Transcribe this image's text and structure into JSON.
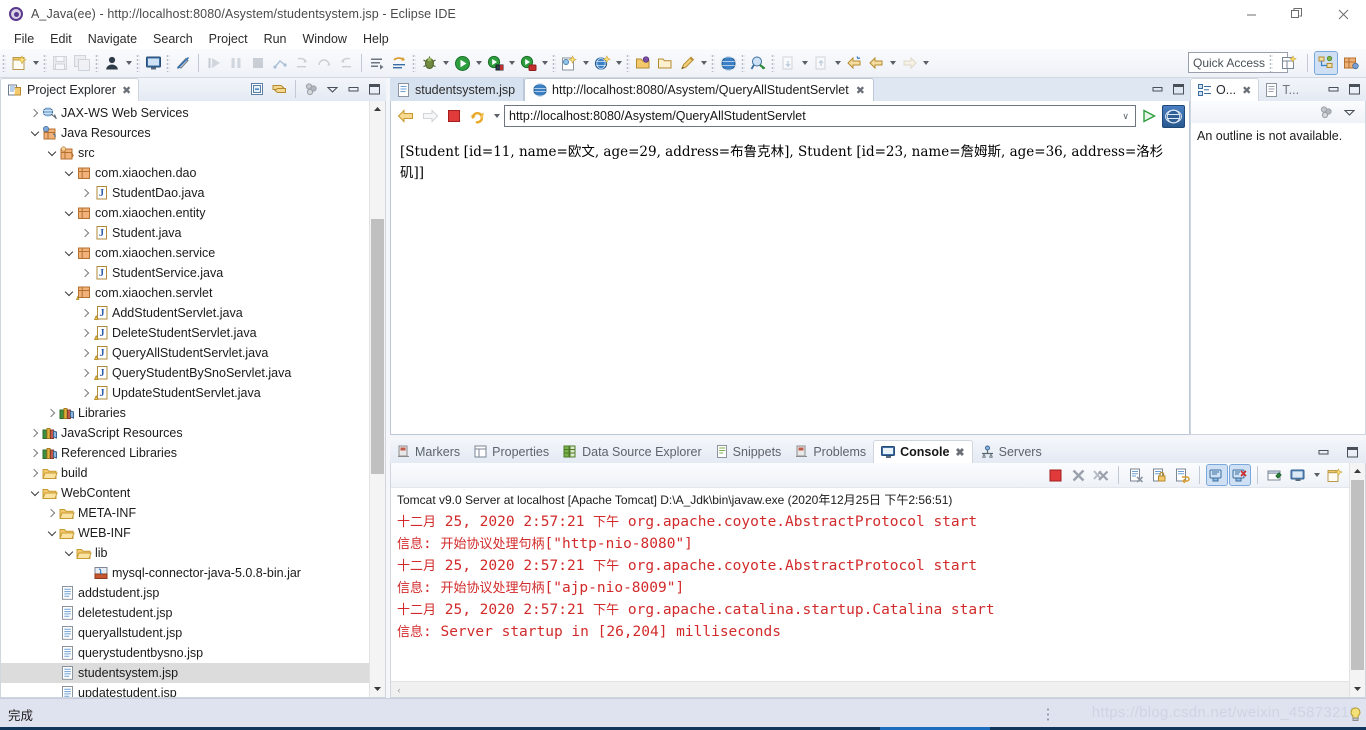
{
  "window": {
    "title": "A_Java(ee) - http://localhost:8080/Asystem/studentsystem.jsp - Eclipse IDE",
    "icon": "eclipse-icon",
    "minimize": "—",
    "maximize": "❐",
    "close": "✕"
  },
  "menubar": {
    "items": [
      {
        "label": "File"
      },
      {
        "label": "Edit"
      },
      {
        "label": "Navigate"
      },
      {
        "label": "Search"
      },
      {
        "label": "Project"
      },
      {
        "label": "Run"
      },
      {
        "label": "Window"
      },
      {
        "label": "Help"
      }
    ]
  },
  "toolbar": {
    "quick_access_placeholder": "Quick Access",
    "buttons": [
      "new-wizard",
      "save",
      "save-all",
      "user-profile",
      "terminal",
      "toggle-mark-occurrences",
      "skip-breakpoints",
      "resume",
      "suspend",
      "terminate",
      "disconnect",
      "step-into",
      "step-over",
      "step-return",
      "drop-to-frame",
      "next-annotation",
      "previous-annotation",
      "debug",
      "run",
      "run-last-tool",
      "coverage",
      "new-jsp",
      "new-dynamic-web-project",
      "open-type",
      "open-task",
      "external-tools",
      "web-browser",
      "search",
      "forward-history",
      "back-history"
    ],
    "perspective_buttons": [
      "open-perspective",
      "java-ee-perspective",
      "java-perspective"
    ]
  },
  "project_explorer": {
    "tab_label": "Project Explorer",
    "tab_close": "✖",
    "toolbar": [
      "collapse-all",
      "link-with-editor",
      "view-menu-dots",
      "view-menu-triangle",
      "minimize",
      "maximize"
    ],
    "tree": [
      {
        "indent": 1,
        "twist": "closed",
        "icon": "web-services-icon",
        "label": "JAX-WS Web Services"
      },
      {
        "indent": 1,
        "twist": "open",
        "icon": "java-resources-icon",
        "label": "Java Resources"
      },
      {
        "indent": 2,
        "twist": "open",
        "icon": "source-folder-icon",
        "label": "src"
      },
      {
        "indent": 3,
        "twist": "open",
        "icon": "package-icon",
        "label": "com.xiaochen.dao"
      },
      {
        "indent": 4,
        "twist": "closed",
        "icon": "java-file-icon",
        "label": "StudentDao.java"
      },
      {
        "indent": 3,
        "twist": "open",
        "icon": "package-icon",
        "label": "com.xiaochen.entity"
      },
      {
        "indent": 4,
        "twist": "closed",
        "icon": "java-file-icon",
        "label": "Student.java"
      },
      {
        "indent": 3,
        "twist": "open",
        "icon": "package-icon",
        "label": "com.xiaochen.service"
      },
      {
        "indent": 4,
        "twist": "closed",
        "icon": "java-file-icon",
        "label": "StudentService.java"
      },
      {
        "indent": 3,
        "twist": "open",
        "icon": "package-warning-icon",
        "label": "com.xiaochen.servlet"
      },
      {
        "indent": 4,
        "twist": "closed",
        "icon": "java-file-warning-icon",
        "label": "AddStudentServlet.java"
      },
      {
        "indent": 4,
        "twist": "closed",
        "icon": "java-file-warning-icon",
        "label": "DeleteStudentServlet.java"
      },
      {
        "indent": 4,
        "twist": "closed",
        "icon": "java-file-warning-icon",
        "label": "QueryAllStudentServlet.java"
      },
      {
        "indent": 4,
        "twist": "closed",
        "icon": "java-file-warning-icon",
        "label": "QueryStudentBySnoServlet.java"
      },
      {
        "indent": 4,
        "twist": "closed",
        "icon": "java-file-warning-icon",
        "label": "UpdateStudentServlet.java"
      },
      {
        "indent": 2,
        "twist": "closed",
        "icon": "library-icon",
        "label": "Libraries"
      },
      {
        "indent": 1,
        "twist": "closed",
        "icon": "library-icon",
        "label": "JavaScript Resources"
      },
      {
        "indent": 1,
        "twist": "closed",
        "icon": "library-icon",
        "label": "Referenced Libraries"
      },
      {
        "indent": 1,
        "twist": "closed",
        "icon": "folder-icon",
        "label": "build"
      },
      {
        "indent": 1,
        "twist": "open",
        "icon": "folder-icon",
        "label": "WebContent"
      },
      {
        "indent": 2,
        "twist": "closed",
        "icon": "folder-icon",
        "label": "META-INF"
      },
      {
        "indent": 2,
        "twist": "open",
        "icon": "folder-icon",
        "label": "WEB-INF"
      },
      {
        "indent": 3,
        "twist": "open",
        "icon": "folder-icon",
        "label": "lib"
      },
      {
        "indent": 4,
        "twist": "none",
        "icon": "jar-icon",
        "label": "mysql-connector-java-5.0.8-bin.jar"
      },
      {
        "indent": 2,
        "twist": "none",
        "icon": "jsp-file-icon",
        "label": "addstudent.jsp"
      },
      {
        "indent": 2,
        "twist": "none",
        "icon": "jsp-file-icon",
        "label": "deletestudent.jsp"
      },
      {
        "indent": 2,
        "twist": "none",
        "icon": "jsp-file-icon",
        "label": "queryallstudent.jsp"
      },
      {
        "indent": 2,
        "twist": "none",
        "icon": "jsp-file-icon",
        "label": "querystudentbysno.jsp"
      },
      {
        "indent": 2,
        "twist": "none",
        "icon": "jsp-file-icon",
        "label": "studentsystem.jsp",
        "selected": true
      },
      {
        "indent": 2,
        "twist": "none",
        "icon": "jsp-file-icon",
        "label": "updatestudent.jsp"
      }
    ]
  },
  "editor": {
    "tabs": [
      {
        "label": "studentsystem.jsp",
        "icon": "jsp-file-icon",
        "active": false,
        "closable": false
      },
      {
        "label": "http://localhost:8080/Asystem/QueryAllStudentServlet",
        "icon": "globe-icon",
        "active": true,
        "closable": true,
        "close": "✖"
      }
    ],
    "panel_buttons": [
      "minimize",
      "maximize"
    ],
    "browser": {
      "back": "back-arrow-icon",
      "forward": "forward-arrow-icon",
      "stop": "stop-icon",
      "refresh": "refresh-icon",
      "dropdown": "chevron-down-icon",
      "url": "http://localhost:8080/Asystem/QueryAllStudentServlet",
      "url_chevron": "∨",
      "go": "go-icon",
      "home": "open-external-browser-icon",
      "content": "[Student [id=11, name=欧文, age=29, address=布鲁克林], Student [id=23, name=詹姆斯, age=36, address=洛杉矶]]"
    }
  },
  "outline": {
    "tabs": [
      {
        "label": "O...",
        "icon": "outline-icon",
        "active": true,
        "close": "✖"
      },
      {
        "label": "T...",
        "icon": "task-list-icon",
        "active": false
      }
    ],
    "panel_buttons": [
      "minimize",
      "maximize"
    ],
    "toolbar": [
      "view-menu-dots",
      "view-menu-triangle"
    ],
    "message": "An outline is not available."
  },
  "bottom_panel": {
    "tabs": [
      {
        "label": "Markers",
        "icon": "markers-icon",
        "active": false
      },
      {
        "label": "Properties",
        "icon": "properties-icon",
        "active": false
      },
      {
        "label": "Data Source Explorer",
        "icon": "data-source-icon",
        "active": false
      },
      {
        "label": "Snippets",
        "icon": "snippets-icon",
        "active": false
      },
      {
        "label": "Problems",
        "icon": "problems-icon",
        "active": false
      },
      {
        "label": "Console",
        "icon": "console-icon",
        "active": true,
        "close": "✖"
      },
      {
        "label": "Servers",
        "icon": "servers-icon",
        "active": false
      }
    ],
    "panel_buttons": [
      "minimize",
      "maximize"
    ],
    "toolbar": [
      "terminate-icon",
      "remove-launch-icon",
      "remove-all-launches-icon",
      "clear-console-icon",
      "scroll-lock-icon",
      "word-wrap-icon",
      "show-console-on-output-icon",
      "show-console-on-error-icon",
      "pin-console-icon",
      "display-selected-console-icon",
      "console-dropdown-icon",
      "open-console-icon",
      "open-console-dropdown-icon"
    ],
    "console": {
      "header": "Tomcat v9.0 Server at localhost [Apache Tomcat] D:\\A_Jdk\\bin\\javaw.exe (2020年12月25日 下午2:56:51)",
      "lines": [
        "十二月 25, 2020 2:57:21 下午 org.apache.coyote.AbstractProtocol start",
        "信息: 开始协议处理句柄[\"http-nio-8080\"]",
        "十二月 25, 2020 2:57:21 下午 org.apache.coyote.AbstractProtocol start",
        "信息: 开始协议处理句柄[\"ajp-nio-8009\"]",
        "十二月 25, 2020 2:57:21 下午 org.apache.catalina.startup.Catalina start",
        "信息: Server startup in [26,204] milliseconds"
      ],
      "text_color": "#d22a2a",
      "scroll_left": "‹"
    }
  },
  "statusbar": {
    "text": "完成",
    "watermark": "https://blog.csdn.net/weixin_45873215"
  }
}
